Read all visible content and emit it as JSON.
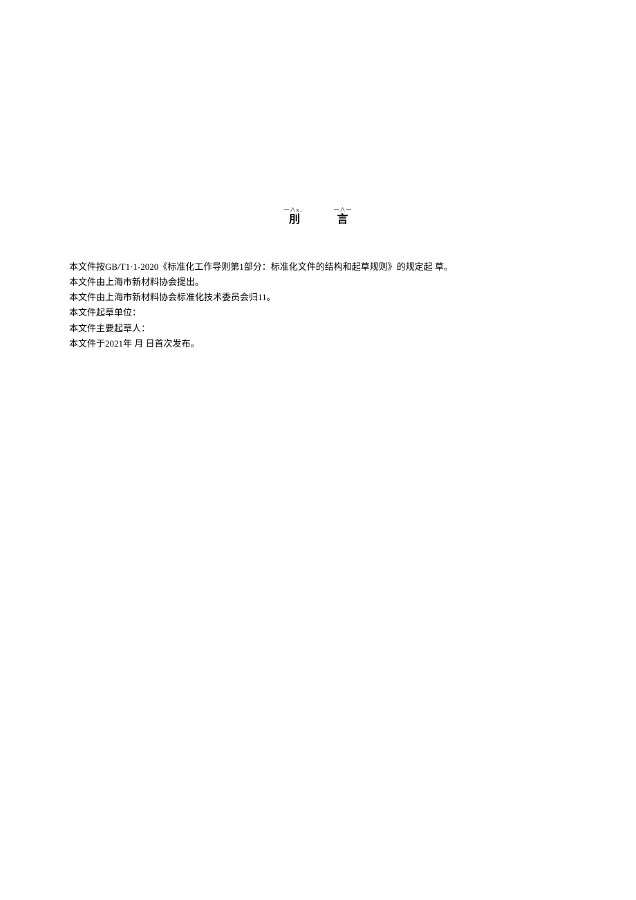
{
  "header": {
    "col1_small": "一∧x．",
    "col1_big": "刖",
    "col2_small": "一∧一",
    "col2_big": "言"
  },
  "paragraphs": [
    "本文件按GB/T1·1-2020《标准化工作导则第1部分：标准化文件的结构和起草规则》的规定起  草。",
    "本文件由上海市新材料协会提出。",
    "本文件由上海市新材料协会标准化技术委员会归11。",
    "本文件起草单位：",
    "本文件主要起草人：",
    "本文件于2021年  月 日首次发布。"
  ]
}
